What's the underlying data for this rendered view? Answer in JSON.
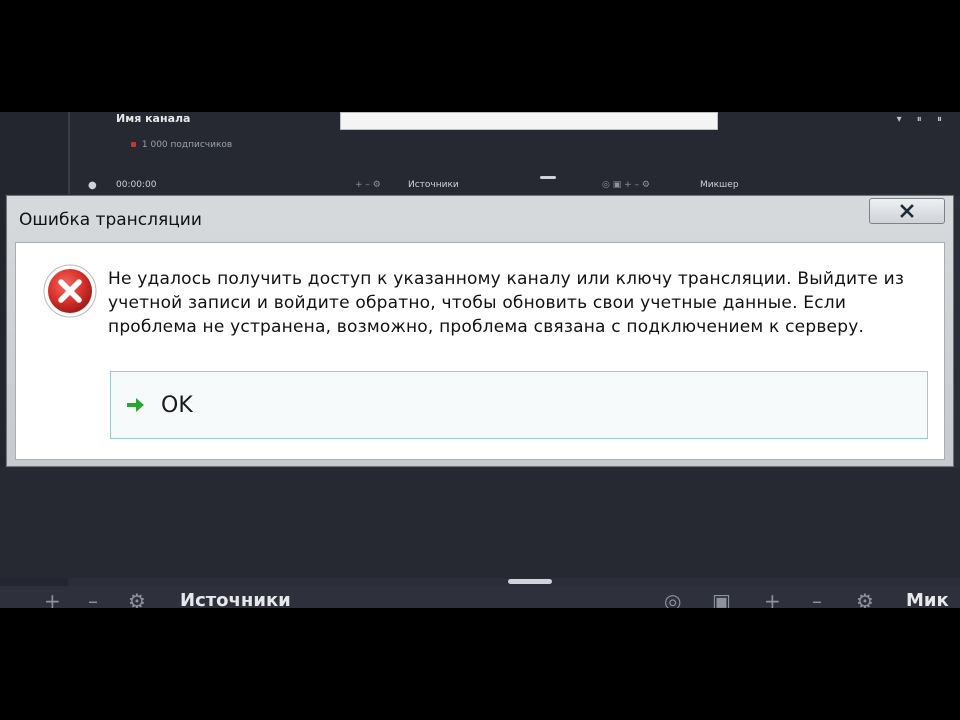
{
  "background_app": {
    "panel_title": "Имя канала",
    "subscribers_text": "1 000 подписчиков",
    "row_left": "00:00:00",
    "row_sources": "Источники",
    "row_mixer": "Микшер",
    "bottom_sources": "Источники",
    "bottom_mixer": "Мик",
    "top_icons": "▾ ⏸ ⏸"
  },
  "dialog": {
    "title": "Ошибка трансляции",
    "message": "Не удалось получить доступ к указанному каналу или ключу трансляции. Выйдите из учетной записи и войдите обратно, чтобы обновить свои учетные данные. Если проблема не устранена, возможно, проблема связана с подключением к серверу.",
    "ok_label": "OK",
    "icons": {
      "error": "error-icon",
      "close": "close-icon",
      "ok_arrow": "green-arrow-icon"
    }
  },
  "colors": {
    "app_bg": "#2b2e38",
    "dialog_frame": "#d0d3d6",
    "error_red": "#d9312b",
    "arrow_green": "#2aa532",
    "ok_border": "#9fc7d8"
  }
}
